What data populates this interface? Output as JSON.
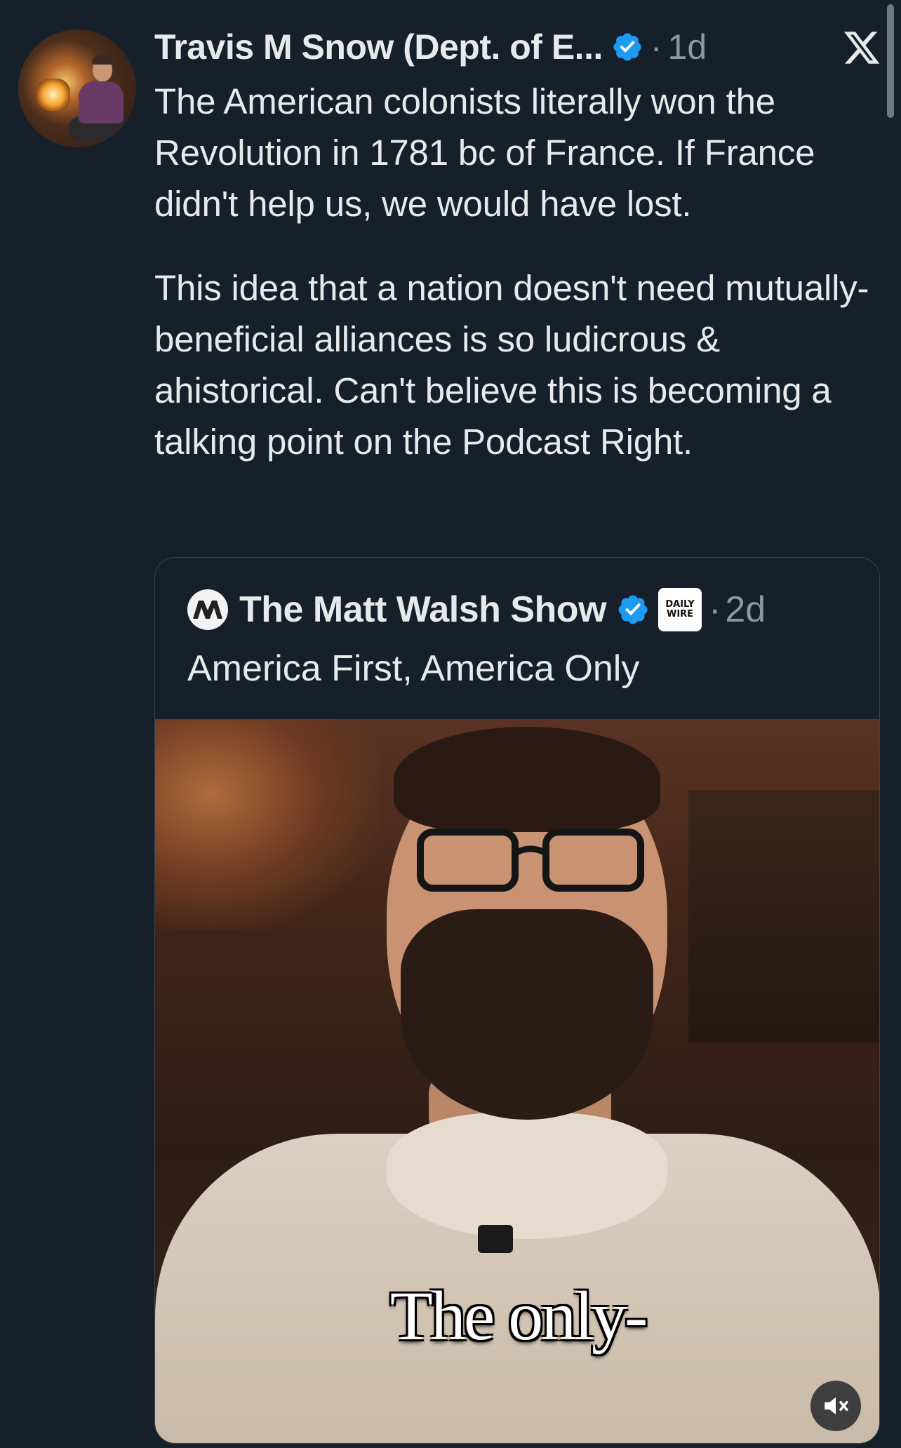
{
  "tweet": {
    "author_name": "Travis M Snow (Dept. of E...",
    "verified_icon": "verified-badge-icon",
    "separator": "·",
    "time": "1d",
    "paragraphs": [
      "The American colonists literally won the Revolution in 1781 bc of France. If France didn't help us, we would have lost.",
      "This idea that a nation doesn't need mutually-beneficial alliances is so ludicrous & ahistorical. Can't believe this is becoming a talking point on the Podcast Right."
    ]
  },
  "platform_icon": "x-logo-icon",
  "quoted_tweet": {
    "author_name": "The Matt Walsh Show",
    "affiliation_badge": [
      "DAILY",
      "WIRE"
    ],
    "separator": "·",
    "time": "2d",
    "text": "America First, America Only",
    "video": {
      "caption": "The only-",
      "mute_icon": "speaker-muted-icon"
    }
  },
  "colors": {
    "background": "#15202b",
    "text": "#e7e9ea",
    "muted": "#8b98a5",
    "verified": "#1d9bf0",
    "border": "#38444d"
  }
}
